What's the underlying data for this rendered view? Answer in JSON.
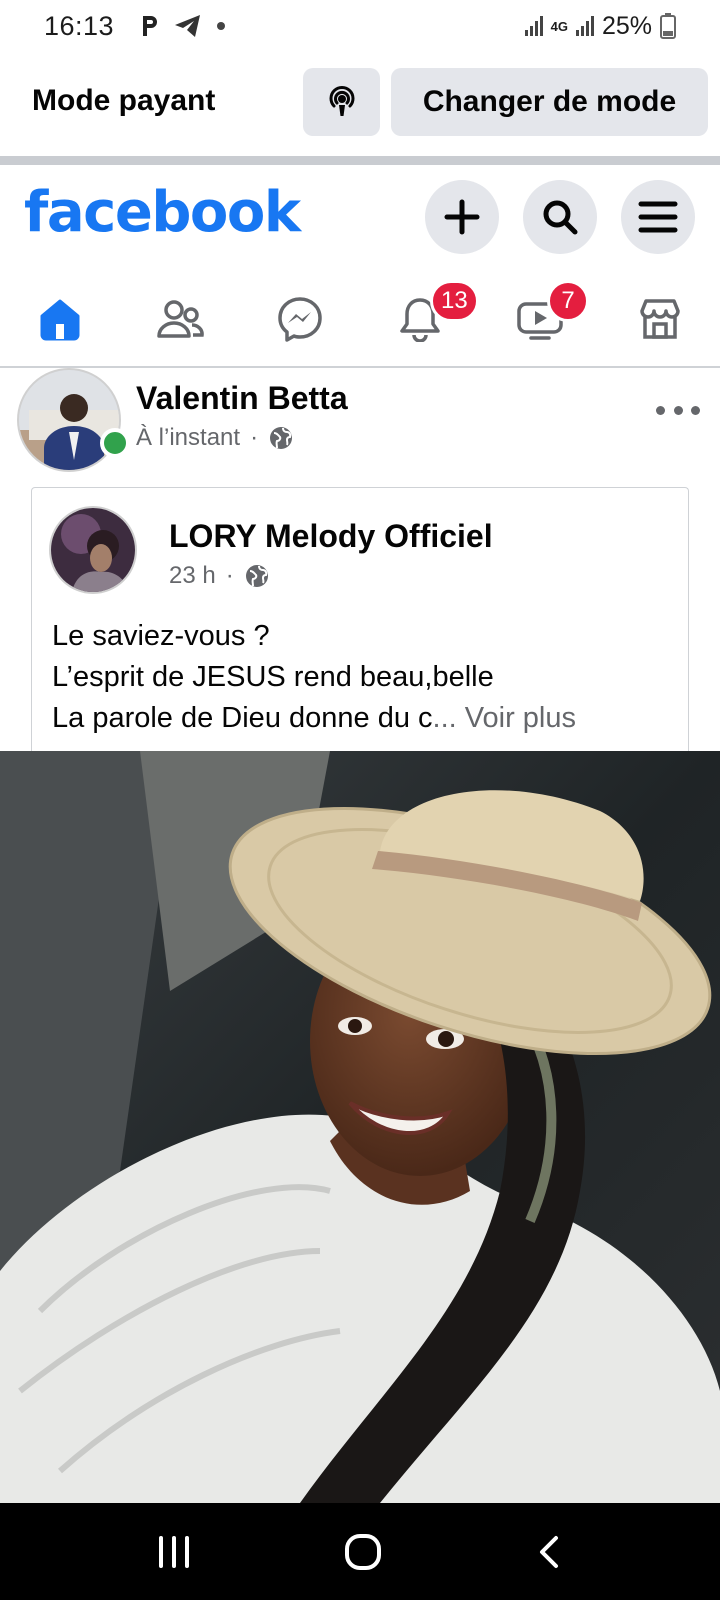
{
  "status_bar": {
    "time": "16:13",
    "network": "4G",
    "battery": "25%",
    "left_icons": [
      "parking-icon",
      "telegram-icon",
      "dot-icon"
    ]
  },
  "mode_bar": {
    "label": "Mode payant",
    "switch_button": "Changer de mode",
    "podcast_icon": "podcast-icon"
  },
  "header": {
    "logo": "facebook",
    "brand_color": "#1877f2",
    "buttons": [
      "plus-icon",
      "search-icon",
      "menu-icon"
    ]
  },
  "nav": {
    "tabs": [
      {
        "name": "home",
        "icon": "home-icon",
        "active": true
      },
      {
        "name": "friends",
        "icon": "friends-icon",
        "active": false
      },
      {
        "name": "messenger",
        "icon": "messenger-icon",
        "active": false
      },
      {
        "name": "notifications",
        "icon": "bell-icon",
        "badge": "13"
      },
      {
        "name": "video",
        "icon": "video-icon",
        "badge": "7"
      },
      {
        "name": "marketplace",
        "icon": "marketplace-icon",
        "active": false
      }
    ]
  },
  "post": {
    "author": "Valentin Betta",
    "time": "À l’instant",
    "separator": "·",
    "shared": {
      "author": "LORY Melody Officiel",
      "time": "23 h",
      "separator": "·",
      "text_lines": [
        "Le saviez-vous ?",
        "L’esprit de JESUS rend beau,belle",
        "La parole de Dieu donne du c"
      ],
      "ellipsis": "...",
      "see_more": "Voir plus"
    }
  },
  "android_nav": [
    "recent-apps-icon",
    "home-circle-icon",
    "back-icon"
  ]
}
